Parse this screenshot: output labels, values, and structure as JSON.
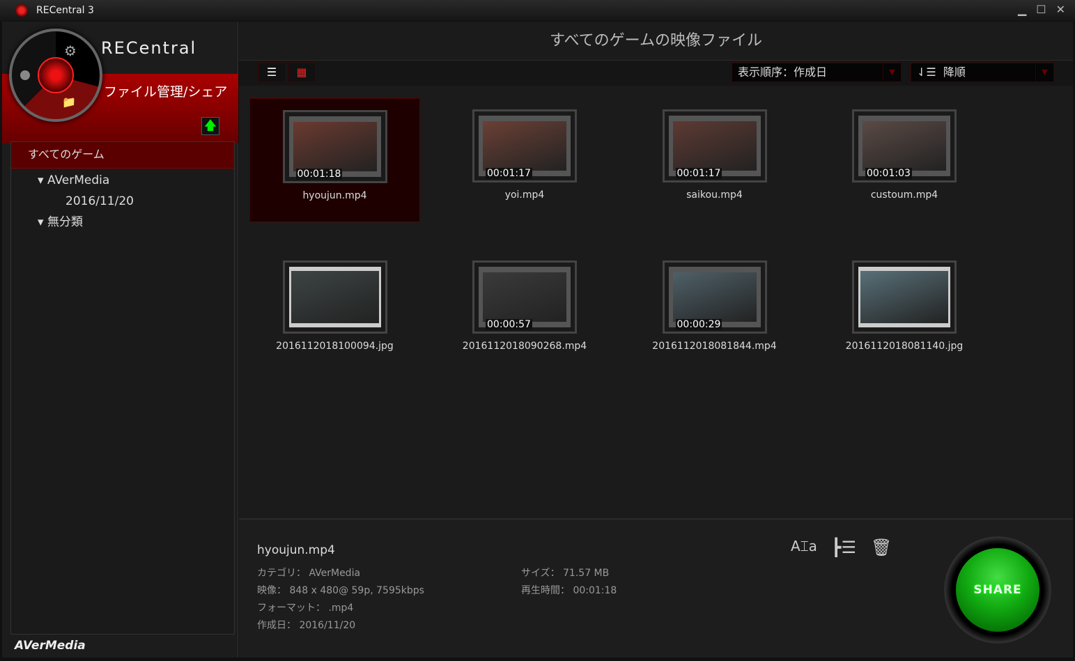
{
  "window": {
    "title": "RECentral 3"
  },
  "sidebar": {
    "logo": "RECentral",
    "section": "ファイル管理/シェア",
    "all_games": "すべてのゲーム",
    "tree": [
      {
        "label": "AVerMedia",
        "child": "2016/11/20"
      },
      {
        "label": "無分類"
      }
    ],
    "brand": "AVerMedia"
  },
  "main": {
    "title": "すべてのゲームの映像ファイル",
    "sort": "表示順序：作成日",
    "order": "降順",
    "items": [
      {
        "name": "hyoujun.mp4",
        "duration": "00:01:18",
        "type": "video"
      },
      {
        "name": "yoi.mp4",
        "duration": "00:01:17",
        "type": "video"
      },
      {
        "name": "saikou.mp4",
        "duration": "00:01:17",
        "type": "video"
      },
      {
        "name": "custoum.mp4",
        "duration": "00:01:03",
        "type": "video"
      },
      {
        "name": "2016112018100094.jpg",
        "duration": null,
        "type": "photo"
      },
      {
        "name": "2016112018090268.mp4",
        "duration": "00:00:57",
        "type": "video"
      },
      {
        "name": "2016112018081844.mp4",
        "duration": "00:00:29",
        "type": "video"
      },
      {
        "name": "2016112018081140.jpg",
        "duration": null,
        "type": "photo"
      }
    ]
  },
  "details": {
    "name": "hyoujun.mp4",
    "category": "カテゴリ： AVerMedia",
    "video": "映像： 848 x 480@ 59p, 7595kbps",
    "format": "フォーマット： .mp4",
    "created": "作成日： 2016/11/20",
    "size": "サイズ： 71.57 MB",
    "duration": "再生時間： 00:01:18",
    "share": "SHARE"
  }
}
